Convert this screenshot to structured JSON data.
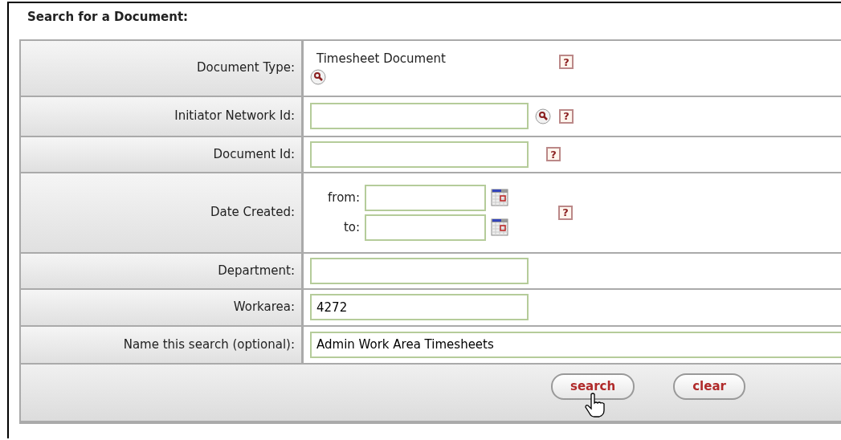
{
  "title": "Search for a Document:",
  "rows": [
    {
      "label": "Document Type:",
      "kind": "static",
      "value": "Timesheet Document",
      "lookup": true,
      "help": "?"
    },
    {
      "label": "Initiator Network Id:",
      "kind": "input",
      "value": "",
      "lookup": true,
      "help": "?"
    },
    {
      "label": "Document Id:",
      "kind": "input",
      "value": "",
      "lookup": false,
      "help": "?"
    },
    {
      "label": "Date Created:",
      "kind": "date_range",
      "from_label": "from:",
      "to_label": "to:",
      "from": "",
      "to": "",
      "help": "?"
    },
    {
      "label": "Department:",
      "kind": "input",
      "value": "",
      "lookup": false
    },
    {
      "label": "Workarea:",
      "kind": "input",
      "value": "4272",
      "lookup": false
    },
    {
      "label": "Name this search (optional):",
      "kind": "wide_input",
      "value": "Admin Work Area Timesheets",
      "lookup": false
    }
  ],
  "buttons": [
    {
      "label": "search",
      "hovered": true
    },
    {
      "label": "clear",
      "hovered": false
    }
  ]
}
